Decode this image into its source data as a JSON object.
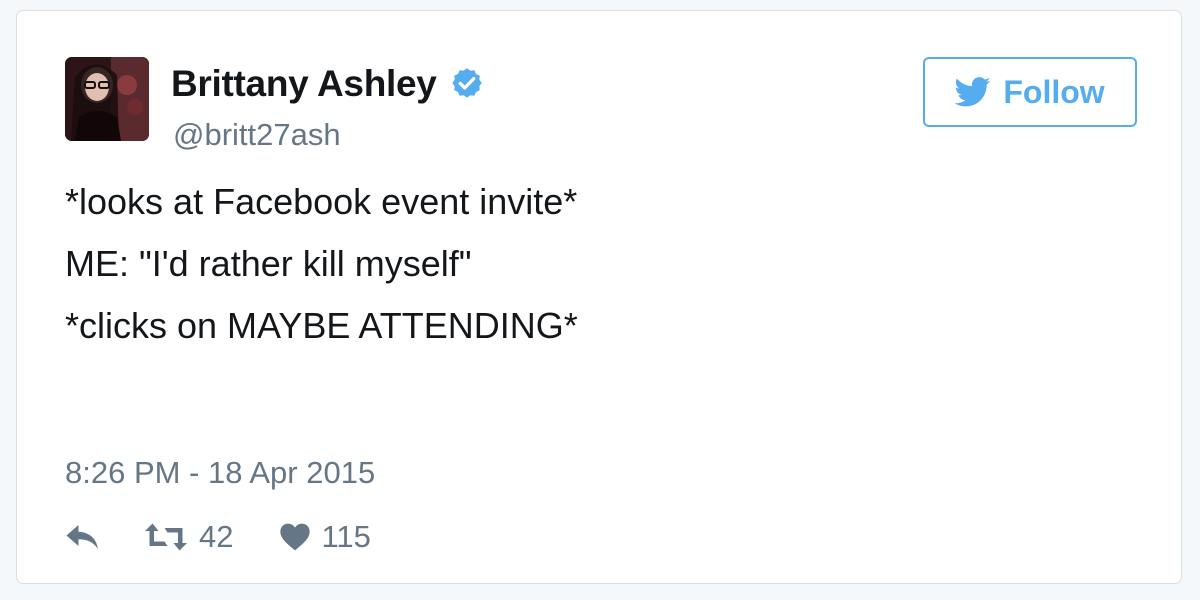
{
  "user": {
    "display_name": "Brittany Ashley",
    "handle": "@britt27ash",
    "verified": true
  },
  "follow_button": {
    "label": "Follow"
  },
  "tweet": {
    "lines": [
      "*looks at Facebook event invite*",
      "ME: \"I'd rather kill myself\"",
      "*clicks on MAYBE ATTENDING*"
    ],
    "timestamp": "8:26 PM - 18 Apr 2015"
  },
  "actions": {
    "reply_icon": "reply-icon",
    "retweet_icon": "retweet-icon",
    "retweet_count": "42",
    "like_icon": "heart-icon",
    "like_count": "115"
  },
  "colors": {
    "accent": "#55acee",
    "text": "#14171a",
    "secondary_text": "#657786",
    "border": "#d8dee2"
  }
}
